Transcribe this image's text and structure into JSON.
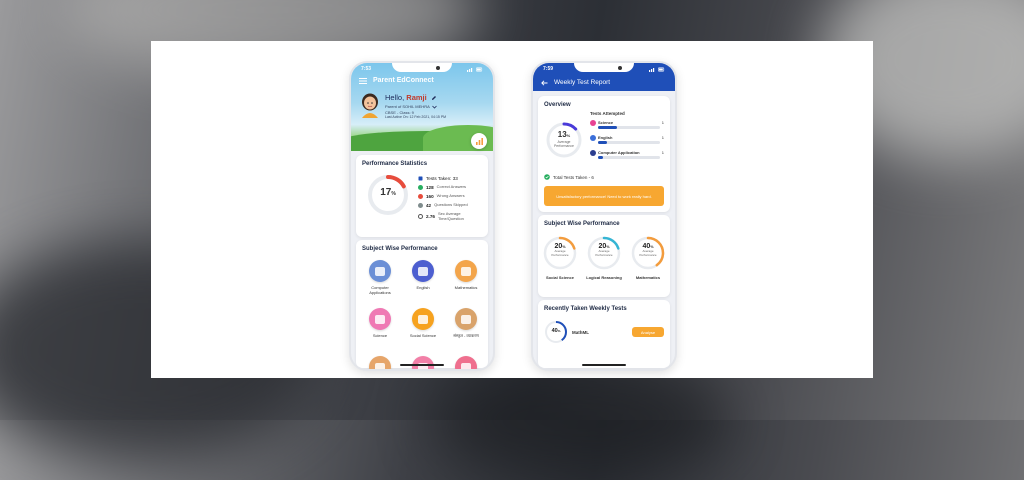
{
  "phone1": {
    "status_time": "7:53",
    "app_title": "Parent EdConnect",
    "hello_prefix": "Hello,",
    "user_name": "Ramji",
    "parent_of": "Parent of SOHIL MEHRA",
    "class_info": "CBSE - Class: 9",
    "last_active": "Last Active On: 12 Feb 2021, 04:15 PM",
    "performance": {
      "title": "Performance Statistics",
      "percent": "17",
      "percent_unit": "%",
      "percent_value": 17,
      "tests_taken_label": "Tests Taken: 33",
      "rows": [
        {
          "value": "128",
          "label": "Correct Answers",
          "color": "#27ae60"
        },
        {
          "value": "160",
          "label": "Wrong Answers",
          "color": "#e74c3c"
        },
        {
          "value": "42",
          "label": "Questions Skipped",
          "color": "#7f8c8d"
        },
        {
          "value": "2.76",
          "label": "Sec Average Time/Question",
          "color": "#ffffff"
        }
      ]
    },
    "subjects": {
      "title": "Subject Wise Performance",
      "items": [
        {
          "label": "Computer Applications",
          "color": "#6b8fd6",
          "icon": "laptop-icon"
        },
        {
          "label": "English",
          "color": "#4d5fd0",
          "icon": "book-icon"
        },
        {
          "label": "Mathematics",
          "color": "#f3a54b",
          "icon": "math-icon"
        },
        {
          "label": "Science",
          "color": "#ef79b4",
          "icon": "flask-icon"
        },
        {
          "label": "Social Science",
          "color": "#f6a21f",
          "icon": "globe-icon"
        },
        {
          "label": "संस्कृत - व्याकरण",
          "color": "#d9a36b",
          "icon": "script-icon"
        },
        {
          "label": "",
          "color": "#e6a56a",
          "icon": "subject-icon"
        },
        {
          "label": "",
          "color": "#f27fa7",
          "icon": "subject-icon"
        },
        {
          "label": "",
          "color": "#ef6f8e",
          "icon": "subject-icon"
        }
      ]
    }
  },
  "phone2": {
    "status_time": "7:59",
    "title": "Weekly Test Report",
    "overview": {
      "title": "Overview",
      "percent": "13",
      "percent_unit": "%",
      "percent_value": 13,
      "avg_label": "Average Performance",
      "tests_attempted_label": "Tests Attempted",
      "subjects": [
        {
          "name": "Science",
          "count": "1",
          "color": "#e84393",
          "fill": 0.3
        },
        {
          "name": "English",
          "count": "1",
          "color": "#3b6fd9",
          "fill": 0.15
        },
        {
          "name": "Computer Application",
          "count": "1",
          "color": "#2c3e8f",
          "fill": 0.08
        }
      ],
      "total_label": "Total Tests Taken - 6",
      "warning": "Unsatisfactory performance! Need to work really hard."
    },
    "subject_wise": {
      "title": "Subject Wise Performance",
      "items": [
        {
          "percent": "20",
          "name": "Social Science",
          "value": 20,
          "color": "#f39c3d"
        },
        {
          "percent": "20",
          "name": "Logical Reasoning",
          "value": 20,
          "color": "#35b5d4"
        },
        {
          "percent": "40",
          "name": "Mathematics",
          "value": 40,
          "color": "#f39c3d"
        }
      ],
      "avg_label": "Average Performance",
      "unit": "%"
    },
    "recent": {
      "title": "Recently Taken Weekly Tests",
      "items": [
        {
          "percent": "40",
          "unit": "%",
          "value": 40,
          "name": "MathML",
          "action": "Analyse"
        }
      ]
    }
  }
}
